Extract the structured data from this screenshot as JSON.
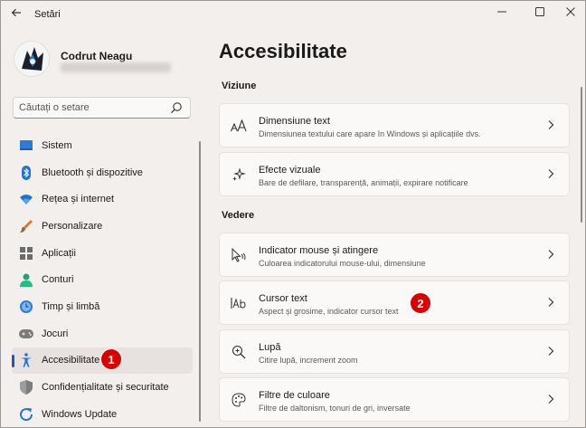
{
  "window": {
    "title": "Setări"
  },
  "profile": {
    "name": "Codrut Neagu"
  },
  "search": {
    "placeholder": "Căutați o setare"
  },
  "sidebar": {
    "items": [
      {
        "label": "Sistem"
      },
      {
        "label": "Bluetooth și dispozitive"
      },
      {
        "label": "Rețea și internet"
      },
      {
        "label": "Personalizare"
      },
      {
        "label": "Aplicații"
      },
      {
        "label": "Conturi"
      },
      {
        "label": "Timp și limbă"
      },
      {
        "label": "Jocuri"
      },
      {
        "label": "Accesibilitate",
        "selected": true
      },
      {
        "label": "Confidențialitate și securitate"
      },
      {
        "label": "Windows Update"
      }
    ]
  },
  "main": {
    "title": "Accesibilitate",
    "sections": [
      {
        "heading": "Viziune",
        "cards": [
          {
            "title": "Dimensiune text",
            "subtitle": "Dimensiunea textului care apare în Windows și aplicațiile dvs.",
            "icon": "text-size-icon"
          },
          {
            "title": "Efecte vizuale",
            "subtitle": "Bare de defilare, transparență, animații, expirare notificare",
            "icon": "sparkle-icon"
          }
        ]
      },
      {
        "heading": "Vedere",
        "cards": [
          {
            "title": "Indicator mouse și atingere",
            "subtitle": "Culoarea indicatorului mouse-ului, dimensiune",
            "icon": "mouse-pointer-icon"
          },
          {
            "title": "Cursor text",
            "subtitle": "Aspect și grosime, indicator cursor text",
            "icon": "text-cursor-icon"
          },
          {
            "title": "Lupă",
            "subtitle": "Citire lupă, increment zoom",
            "icon": "magnifier-icon"
          },
          {
            "title": "Filtre de culoare",
            "subtitle": "Filtre de daltonism, tonuri de gri, inversate",
            "icon": "palette-icon"
          }
        ]
      }
    ]
  },
  "annotations": {
    "badge1": "1",
    "badge2": "2"
  },
  "colors": {
    "accent": "#1f5aa6",
    "badge": "#d90000"
  }
}
